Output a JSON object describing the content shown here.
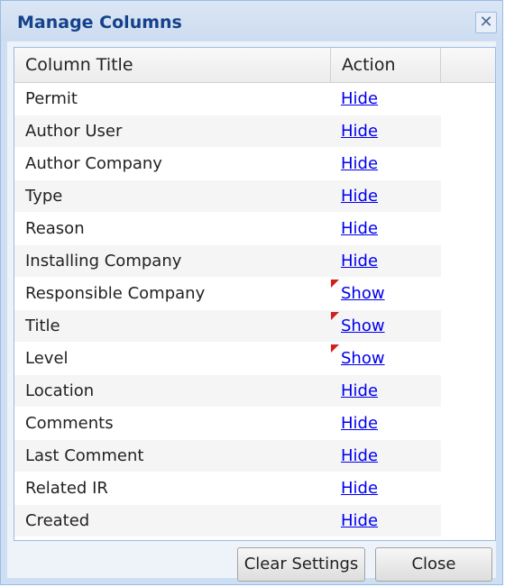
{
  "dialog": {
    "title": "Manage Columns",
    "close_glyph": "✕",
    "close_icon": "close-icon"
  },
  "grid": {
    "headers": {
      "title": "Column Title",
      "action": "Action"
    },
    "rows": [
      {
        "title": "Permit",
        "action": "Hide",
        "modified": false
      },
      {
        "title": "Author User",
        "action": "Hide",
        "modified": false
      },
      {
        "title": "Author Company",
        "action": "Hide",
        "modified": false
      },
      {
        "title": "Type",
        "action": "Hide",
        "modified": false
      },
      {
        "title": "Reason",
        "action": "Hide",
        "modified": false
      },
      {
        "title": "Installing Company",
        "action": "Hide",
        "modified": false
      },
      {
        "title": "Responsible Company",
        "action": "Show",
        "modified": true
      },
      {
        "title": "Title",
        "action": "Show",
        "modified": true
      },
      {
        "title": "Level",
        "action": "Show",
        "modified": true
      },
      {
        "title": "Location",
        "action": "Hide",
        "modified": false
      },
      {
        "title": "Comments",
        "action": "Hide",
        "modified": false
      },
      {
        "title": "Last Comment",
        "action": "Hide",
        "modified": false
      },
      {
        "title": "Related IR",
        "action": "Hide",
        "modified": false
      },
      {
        "title": "Created",
        "action": "Hide",
        "modified": false
      }
    ]
  },
  "footer": {
    "clear_label": "Clear Settings",
    "close_label": "Close"
  },
  "colors": {
    "title_text": "#15428b",
    "link": "#0000ee",
    "modified_marker": "#d02020",
    "dialog_frame": "#cfdff3"
  }
}
